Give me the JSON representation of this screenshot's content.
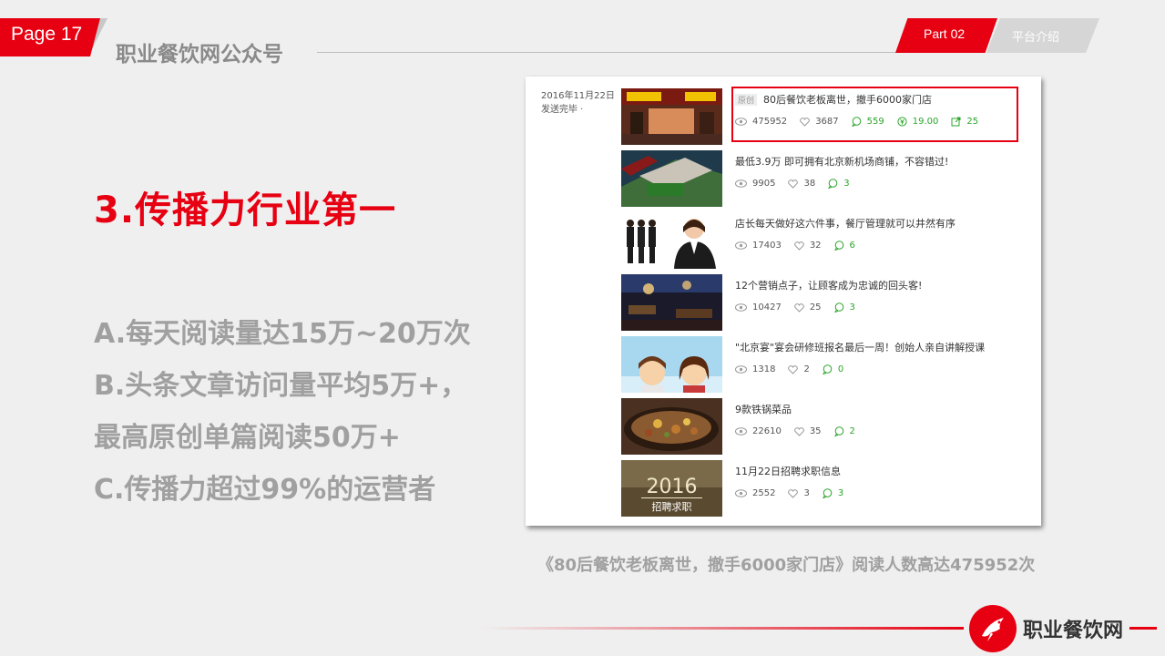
{
  "header": {
    "page_label": "Page 17",
    "title": "职业餐饮网公众号",
    "part_label": "Part 02",
    "section_label": "平台介绍"
  },
  "main": {
    "heading": "3.传播力行业第一",
    "points": [
      "A.每天阅读量达15万~20万次",
      "B.头条文章访问量平均5万+，",
      "最高原创单篇阅读50万+",
      "C.传播力超过99%的运营者"
    ]
  },
  "screenshot": {
    "date_line1": "2016年11月22日",
    "date_line2": "发送完毕 ·",
    "items": [
      {
        "tag": "原创",
        "title": "80后餐饮老板离世，撤手6000家门店",
        "views": "475952",
        "likes": "3687",
        "comments": "559",
        "reward": "19.00",
        "shares": "25"
      },
      {
        "title": "最低3.9万 即可拥有北京新机场商铺，不容错过!",
        "views": "9905",
        "likes": "38",
        "comments": "3"
      },
      {
        "title": "店长每天做好这六件事，餐厅管理就可以井然有序",
        "views": "17403",
        "likes": "32",
        "comments": "6"
      },
      {
        "title": "12个营销点子，让顾客成为忠诚的回头客!",
        "views": "10427",
        "likes": "25",
        "comments": "3"
      },
      {
        "title": "\"北京宴\"宴会研修班报名最后一周！创始人亲自讲解授课",
        "views": "1318",
        "likes": "2",
        "comments": "0"
      },
      {
        "title": "9款铁锅菜品",
        "views": "22610",
        "likes": "35",
        "comments": "2"
      },
      {
        "title": "11月22日招聘求职信息",
        "views": "2552",
        "likes": "3",
        "comments": "3",
        "thumb_year": "2016",
        "thumb_text": "招聘求职"
      }
    ]
  },
  "caption": "《80后餐饮老板离世，撤手6000家门店》阅读人数高达475952次",
  "footer": {
    "logo_text": "职业餐饮网"
  },
  "colors": {
    "accent": "#e60012",
    "muted_text": "#a0a0a0",
    "comment_green": "#2aa52a"
  }
}
